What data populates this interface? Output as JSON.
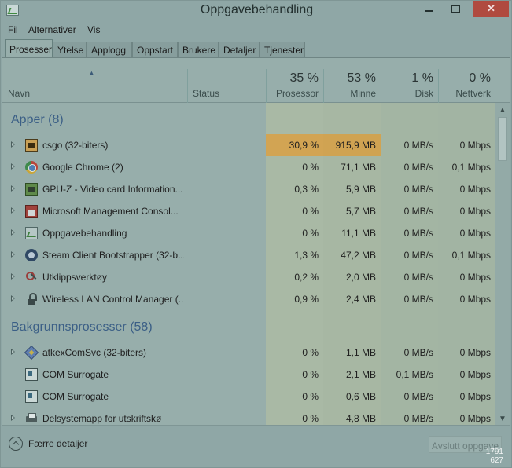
{
  "window": {
    "title": "Oppgavebehandling",
    "minimize_glyph": "—",
    "close_glyph": "✕"
  },
  "menu": [
    "Fil",
    "Alternativer",
    "Vis"
  ],
  "tabs": [
    "Prosesser",
    "Ytelse",
    "Applogg",
    "Oppstart",
    "Brukere",
    "Detaljer",
    "Tjenester"
  ],
  "active_tab": "Prosesser",
  "columns": {
    "name": "Navn",
    "status": "Status",
    "cpu": {
      "pct": "35 %",
      "label": "Prosessor"
    },
    "memory": {
      "pct": "53 %",
      "label": "Minne"
    },
    "disk": {
      "pct": "1 %",
      "label": "Disk"
    },
    "network": {
      "pct": "0 %",
      "label": "Nettverk"
    }
  },
  "groups": {
    "apps": {
      "title": "Apper (8)",
      "rows": [
        {
          "icon": "csgo-icon",
          "name": "csgo (32-biters)",
          "cpu": "30,9 %",
          "mem": "915,9 MB",
          "disk": "0 MB/s",
          "net": "0 Mbps"
        },
        {
          "icon": "chrome-icon",
          "name": "Google Chrome (2)",
          "cpu": "0 %",
          "mem": "71,1 MB",
          "disk": "0 MB/s",
          "net": "0,1 Mbps"
        },
        {
          "icon": "gpu-z-icon",
          "name": "GPU-Z - Video card Information...",
          "cpu": "0,3 %",
          "mem": "5,9 MB",
          "disk": "0 MB/s",
          "net": "0 Mbps"
        },
        {
          "icon": "mmc-icon",
          "name": "Microsoft Management Consol...",
          "cpu": "0 %",
          "mem": "5,7 MB",
          "disk": "0 MB/s",
          "net": "0 Mbps"
        },
        {
          "icon": "task-manager-icon",
          "name": "Oppgavebehandling",
          "cpu": "0 %",
          "mem": "11,1 MB",
          "disk": "0 MB/s",
          "net": "0 Mbps"
        },
        {
          "icon": "steam-icon",
          "name": "Steam Client Bootstrapper (32-b...",
          "cpu": "1,3 %",
          "mem": "47,2 MB",
          "disk": "0 MB/s",
          "net": "0,1 Mbps"
        },
        {
          "icon": "snipping-tool-icon",
          "name": "Utklippsverktøy",
          "cpu": "0,2 %",
          "mem": "2,0 MB",
          "disk": "0 MB/s",
          "net": "0 Mbps"
        },
        {
          "icon": "wireless-lan-icon",
          "name": "Wireless LAN Control Manager (...",
          "cpu": "0,9 %",
          "mem": "2,4 MB",
          "disk": "0 MB/s",
          "net": "0 Mbps"
        }
      ]
    },
    "background": {
      "title": "Bakgrunnsprosesser (58)",
      "rows": [
        {
          "icon": "atkex-icon",
          "name": "atkexComSvc (32-biters)",
          "cpu": "0 %",
          "mem": "1,1 MB",
          "disk": "0 MB/s",
          "net": "0 Mbps",
          "expandable": true
        },
        {
          "icon": "com-surrogate-icon",
          "name": "COM Surrogate",
          "cpu": "0 %",
          "mem": "2,1 MB",
          "disk": "0,1 MB/s",
          "net": "0 Mbps",
          "expandable": false
        },
        {
          "icon": "com-surrogate-icon",
          "name": "COM Surrogate",
          "cpu": "0 %",
          "mem": "0,6 MB",
          "disk": "0 MB/s",
          "net": "0 Mbps",
          "expandable": false
        },
        {
          "icon": "printer-icon",
          "name": "Delsystemapp for utskriftskø",
          "cpu": "0 %",
          "mem": "4,8 MB",
          "disk": "0 MB/s",
          "net": "0 Mbps",
          "expandable": true
        }
      ]
    }
  },
  "footer": {
    "fewer_details": "Færre detaljer",
    "end_task": "Avslutt oppgave",
    "resolution": [
      "1791",
      "627"
    ]
  },
  "colors": {
    "csgo_cpu": "#d2a453",
    "csgo_mem": "#d0a352",
    "cpu_band": "#c9bd8b",
    "mem_band": "#c5b885",
    "disk_band": "#c1b989",
    "net_band": "#c0b98a",
    "group_title": "#3b5f86"
  }
}
